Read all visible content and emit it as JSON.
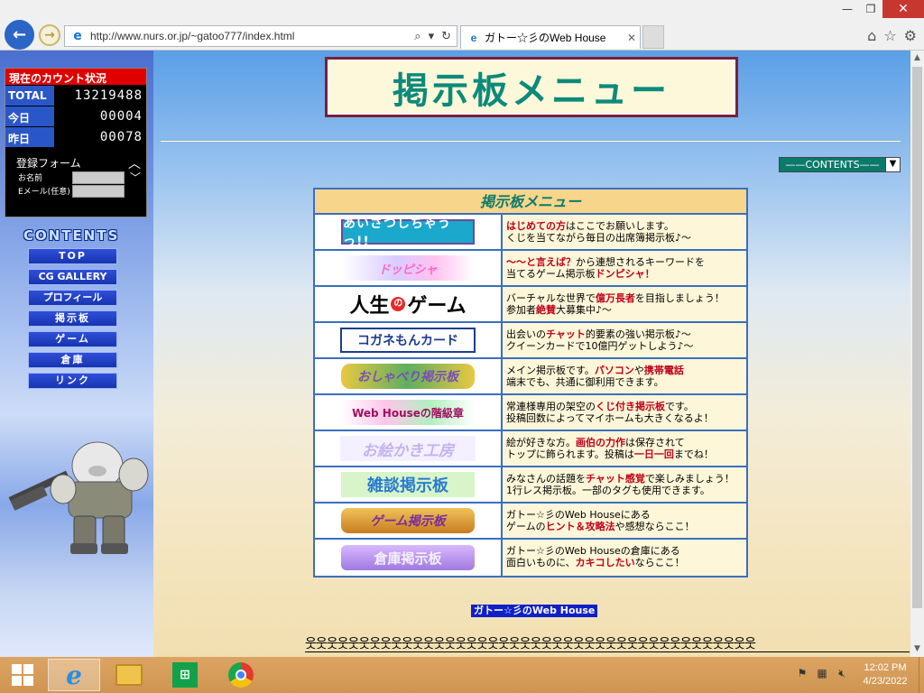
{
  "browser": {
    "url": "http://www.nurs.or.jp/~gatoo777/index.html",
    "tab_title": "ガトー☆彡のWeb House",
    "window_controls": {
      "minimize": "—",
      "restore": "❐",
      "close": "✕"
    }
  },
  "counter": {
    "title": "現在のカウント状況",
    "rows": [
      {
        "label": "TOTAL",
        "value": "13219488"
      },
      {
        "label": "今日",
        "value": "00004"
      },
      {
        "label": "昨日",
        "value": "00078"
      }
    ],
    "register_label": "登録フォーム",
    "name_label": "お名前",
    "email_label": "Eメール(任意)"
  },
  "sidebar": {
    "contents_title": "CONTENTS",
    "items": [
      "TOP",
      "CG GALLERY",
      "プロフィール",
      "掲示板",
      "ゲーム",
      "倉庫",
      "リンク"
    ]
  },
  "main": {
    "page_title": "掲示板メニュー",
    "contents_select": "——CONTENTS——",
    "table_title": "掲示板メニュー",
    "rows": [
      {
        "banner": "あいさつしちゃうっ!!",
        "line1_red": "はじめての方",
        "line1_rest": "はここでお願いします。",
        "line2": "くじを当てながら毎日の出席簿掲示板♪〜"
      },
      {
        "banner": "ドッピシャ",
        "line1_red": "〜〜と言えば？",
        "line1_rest": "から連想されるキーワードを",
        "line2_pre": "当てるゲーム掲示板",
        "line2_red": "ドンピシャ！"
      },
      {
        "banner": "人生のゲーム",
        "line1_pre": "バーチャルな世界で",
        "line1_red": "億万長者",
        "line1_rest": "を目指しましょう！",
        "line2_pre": "参加者",
        "line2_red": "絶賛",
        "line2": "大募集中♪〜"
      },
      {
        "banner": "コガネもんカード",
        "line1_pre": "出会いの",
        "line1_red": "チャット",
        "line1_rest": "的要素の強い掲示板♪〜",
        "line2": "クイーンカードで10億円ゲットしよう♪〜"
      },
      {
        "banner": "おしゃべり掲示板",
        "line1_pre": "メイン掲示板です。",
        "line1_red": "パソコン",
        "line1_mid": "や",
        "line1_red2": "携帯電話",
        "line2": "端末でも、共通に御利用できます。"
      },
      {
        "banner": "Web Houseの階級章",
        "line1_pre": "常連様専用の架空の",
        "line1_red": "くじ付き掲示板",
        "line1_rest": "です。",
        "line2": "投稿回数によってマイホームも大きくなるよ！"
      },
      {
        "banner": "お絵かき工房",
        "line1_pre": "絵が好きな方。",
        "line1_red": "画伯の力作",
        "line1_rest": "は保存されて",
        "line2_pre": "トップに飾られます。投稿は",
        "line2_red": "一日一回",
        "line2": "までね！"
      },
      {
        "banner": "雑談掲示板",
        "line1_pre": "みなさんの話題を",
        "line1_red": "チャット感覚",
        "line1_rest": "で楽しみましょう！",
        "line2": "1行レス掲示板。一部のタグも使用できます。"
      },
      {
        "banner": "ゲーム掲示板",
        "line1_pre": "ガトー☆彡のWeb Houseにある",
        "line2_pre": "ゲームの",
        "line2_red": "ヒント＆攻略法",
        "line2": "や感想ならここ！"
      },
      {
        "banner": "倉庫掲示板",
        "line1_pre": "ガトー☆彡のWeb Houseの倉庫にある",
        "line2_pre": "面白いものに、",
        "line2_red": "カキコしたい",
        "line2": "ならここ！"
      }
    ],
    "footer_link": "ガトー☆彡のWeb House",
    "footer_people": "웃웃웃웃웃웃웃웃웃웃웃웃웃웃웃웃웃웃웃웃웃웃웃웃웃웃웃웃웃웃웃웃웃웃웃웃웃웃웃웃웃웃"
  },
  "taskbar": {
    "clock_time": "12:02 PM",
    "clock_date": "4/23/2022"
  },
  "colors": {
    "accent_red": "#c0001a",
    "table_border": "#3a6fbf",
    "title_teal": "#0c8a7a"
  }
}
